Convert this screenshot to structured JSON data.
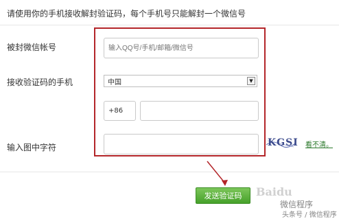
{
  "header": {
    "title": "请使用你的手机接收解封验证码，每个手机号只能解封一个微信号"
  },
  "form": {
    "account_label": "被封微信帐号",
    "account_placeholder": "输入QQ号/手机/邮箱/微信号",
    "phone_label": "接收验证码的手机",
    "country_value": "中国",
    "country_code": "+86",
    "phone_value": "",
    "captcha_label": "输入图中字符",
    "captcha_value": "",
    "captcha_image_text": "KGSI",
    "refresh_link": "看不清。"
  },
  "actions": {
    "send_label": "发送验证码"
  },
  "watermark": {
    "baidu": "Baidu",
    "line1": "微信程序",
    "line2": "头条号 / 微信程序"
  },
  "colors": {
    "highlight": "#b32428",
    "button": "#46a12a"
  }
}
